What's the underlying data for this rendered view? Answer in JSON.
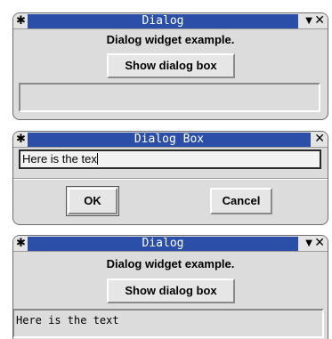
{
  "windows": [
    {
      "title": "Dialog",
      "heading": "Dialog widget example.",
      "button_label": "Show dialog box",
      "result_text": ""
    },
    {
      "title": "Dialog Box",
      "entry_value": "Here is the tex",
      "ok_label": "OK",
      "cancel_label": "Cancel"
    },
    {
      "title": "Dialog",
      "heading": "Dialog widget example.",
      "button_label": "Show dialog box",
      "result_text": "Here is the text"
    }
  ],
  "icons": {
    "pin": "✱",
    "minimize": "▼",
    "close": "✕"
  },
  "colors": {
    "titlebar_active": "#2b4fa8",
    "window_bg": "#dcdcdc"
  }
}
